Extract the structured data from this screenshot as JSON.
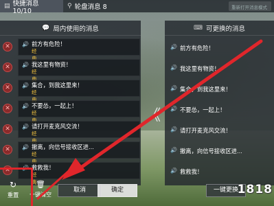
{
  "topbar": {
    "tab_quick": "快捷消息 10/10",
    "tab_wheel": "轮盘消息 8",
    "input_placeholder": "重新打开消息模式"
  },
  "left_panel": {
    "title": "局内使用的消息",
    "items": [
      {
        "text": "前方有危险！",
        "tag": "经典"
      },
      {
        "text": "我这里有物资！",
        "tag": "经典"
      },
      {
        "text": "集合，到我这里来！",
        "tag": "经典"
      },
      {
        "text": "不要怂，一起上！",
        "tag": "经典"
      },
      {
        "text": "请打开麦克风交流！",
        "tag": "经典"
      },
      {
        "text": "撤离，向信号接收区进...",
        "tag": "经典"
      },
      {
        "text": "救救我！",
        "tag": "经典"
      }
    ]
  },
  "right_panel": {
    "title": "可更换的消息",
    "items": [
      {
        "text": "前方有危险！"
      },
      {
        "text": "我这里有物资！"
      },
      {
        "text": "集合，到我这里来！"
      },
      {
        "text": "不要怂，一起上！"
      },
      {
        "text": "请打开麦克风交流！"
      },
      {
        "text": "撤离，向信号接收区进..."
      },
      {
        "text": "救救我！"
      }
    ]
  },
  "bottom": {
    "reset_label": "重置",
    "clear_label": "一键清空",
    "cancel_label": "取消",
    "confirm_label": "确定",
    "swap_label": "一键更换"
  },
  "watermark": "1818",
  "colors": {
    "annotation_red": "#e0262b",
    "tag_gold": "#f0c040"
  }
}
